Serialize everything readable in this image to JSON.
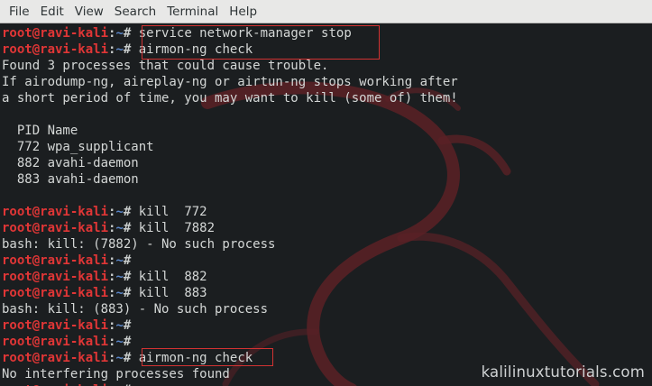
{
  "menu": [
    "File",
    "Edit",
    "View",
    "Search",
    "Terminal",
    "Help"
  ],
  "prompt": {
    "user": "root@ravi-kali",
    "sep": ":",
    "path": "~",
    "hash": "# "
  },
  "lines": [
    {
      "type": "prompt",
      "cmd": "service network-manager stop"
    },
    {
      "type": "prompt",
      "cmd": "airmon-ng check"
    },
    {
      "type": "out",
      "text": "Found 3 processes that could cause trouble."
    },
    {
      "type": "out",
      "text": "If airodump-ng, aireplay-ng or airtun-ng stops working after"
    },
    {
      "type": "out",
      "text": "a short period of time, you may want to kill (some of) them!"
    },
    {
      "type": "out",
      "text": ""
    },
    {
      "type": "out",
      "text": "  PID Name"
    },
    {
      "type": "out",
      "text": "  772 wpa_supplicant"
    },
    {
      "type": "out",
      "text": "  882 avahi-daemon"
    },
    {
      "type": "out",
      "text": "  883 avahi-daemon"
    },
    {
      "type": "out",
      "text": ""
    },
    {
      "type": "prompt",
      "cmd": "kill  772"
    },
    {
      "type": "prompt",
      "cmd": "kill  7882"
    },
    {
      "type": "out",
      "text": "bash: kill: (7882) - No such process"
    },
    {
      "type": "prompt",
      "cmd": ""
    },
    {
      "type": "prompt",
      "cmd": "kill  882"
    },
    {
      "type": "prompt",
      "cmd": "kill  883"
    },
    {
      "type": "out",
      "text": "bash: kill: (883) - No such process"
    },
    {
      "type": "prompt",
      "cmd": ""
    },
    {
      "type": "prompt",
      "cmd": ""
    },
    {
      "type": "prompt",
      "cmd": "airmon-ng check"
    },
    {
      "type": "out",
      "text": "No interfering processes found"
    },
    {
      "type": "prompt",
      "cmd": ""
    }
  ],
  "watermark": "kalilinuxtutorials.com"
}
